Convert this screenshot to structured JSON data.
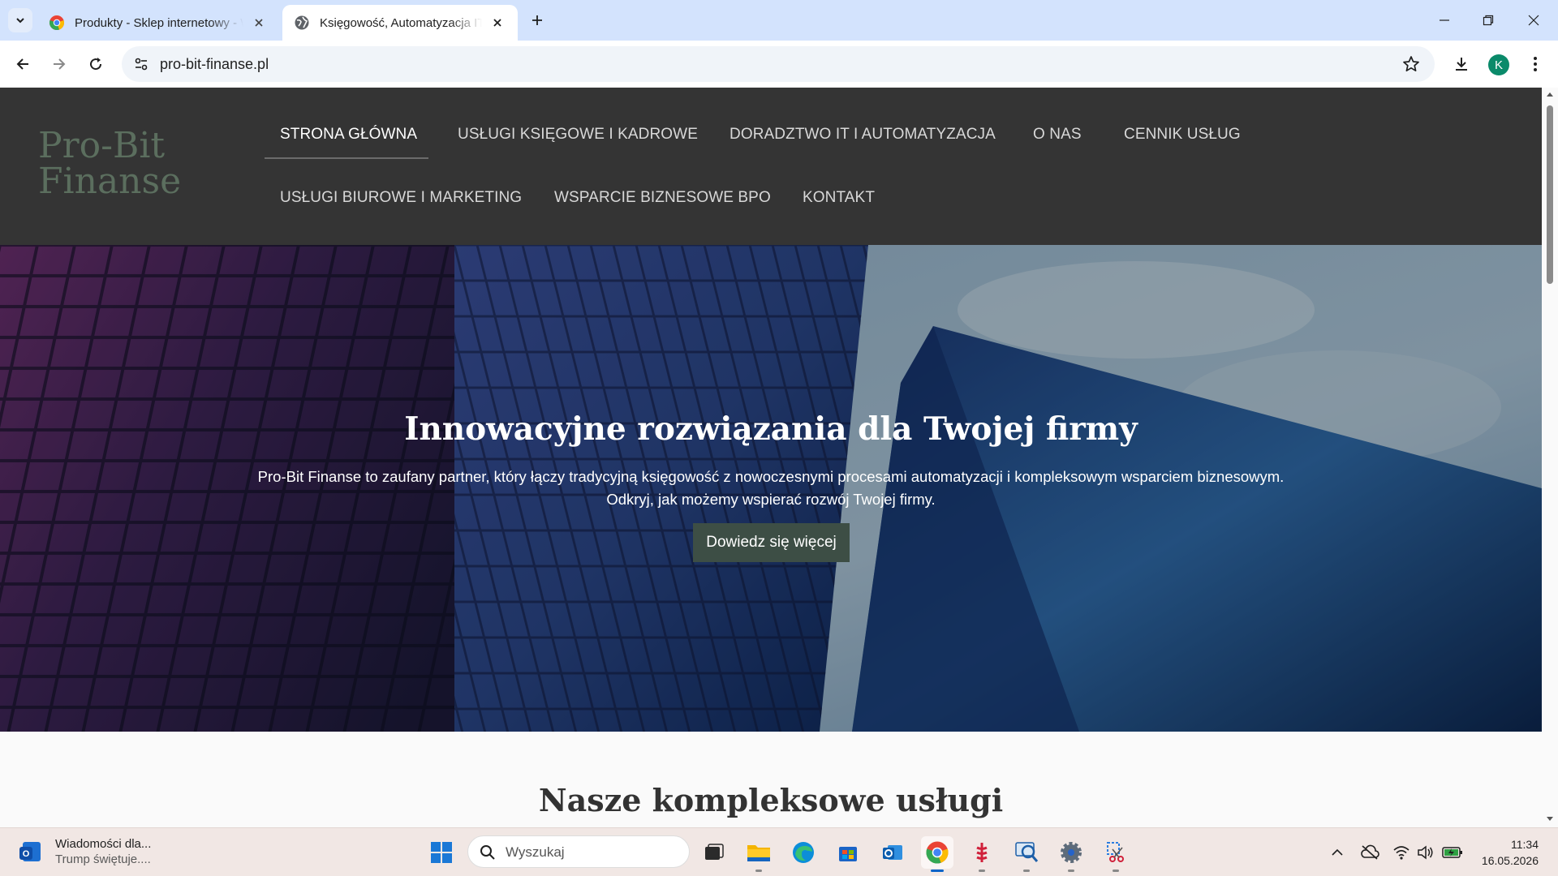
{
  "browser": {
    "tabs": [
      {
        "title": "Produkty - Sklep internetowy - W",
        "active": false
      },
      {
        "title": "Księgowość, Automatyzacja IT i B",
        "active": true
      }
    ],
    "url": "pro-bit-finanse.pl",
    "profile_initial": "K"
  },
  "site": {
    "logo_line1": "Pro-Bit",
    "logo_line2": "Finanse",
    "nav": [
      {
        "label": "STRONA GŁÓWNA",
        "active": true
      },
      {
        "label": "USŁUGI KSIĘGOWE I KADROWE",
        "active": false
      },
      {
        "label": "DORADZTWO IT I AUTOMATYZACJA",
        "active": false
      },
      {
        "label": "O NAS",
        "active": false
      },
      {
        "label": "CENNIK USŁUG",
        "active": false
      },
      {
        "label": "USŁUGI BIUROWE I MARKETING",
        "active": false
      },
      {
        "label": "WSPARCIE BIZNESOWE BPO",
        "active": false
      },
      {
        "label": "KONTAKT",
        "active": false
      }
    ],
    "hero": {
      "title": "Innowacyjne rozwiązania dla Twojej firmy",
      "text": "Pro-Bit Finanse to zaufany partner, który łączy tradycyjną księgowość z nowoczesnymi procesami automatyzacji i kompleksowym wsparciem biznesowym. Odkryj, jak możemy wspierać rozwój Twojej firmy.",
      "button": "Dowiedz się więcej"
    },
    "section_title": "Nasze kompleksowe usługi"
  },
  "taskbar": {
    "news_title": "Wiadomości dla...",
    "news_sub": "Trump świętuje....",
    "search_placeholder": "Wyszukaj",
    "apps": [
      "task-view",
      "file-explorer",
      "edge",
      "store",
      "outlook",
      "chrome",
      "app-red",
      "magnifier",
      "settings",
      "snipping-tool"
    ],
    "time": "11:34",
    "date": "16.05.2026"
  },
  "colors": {
    "header_bg": "#343434",
    "logo": "#5b6e5e",
    "hero_button": "#3d4e45",
    "tabbar": "#d3e3fd"
  }
}
